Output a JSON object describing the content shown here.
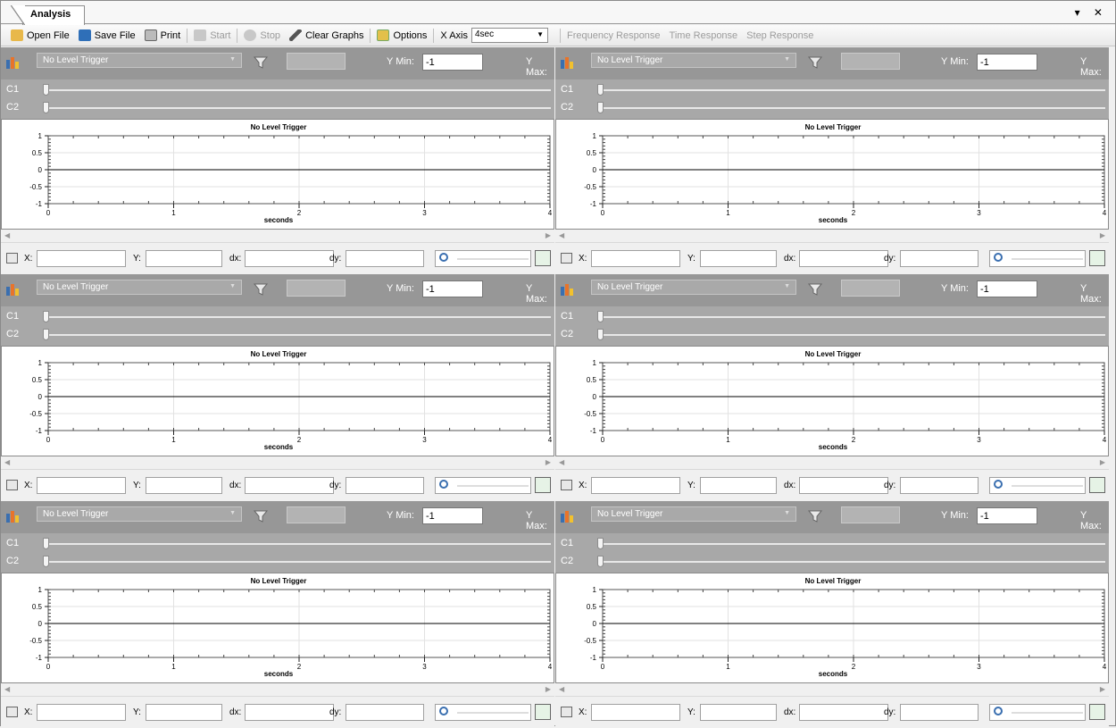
{
  "tab": {
    "label": "Analysis"
  },
  "window_controls": "▾ ✕",
  "toolbar": {
    "open": "Open File",
    "save": "Save File",
    "print": "Print",
    "start": "Start",
    "stop": "Stop",
    "clear": "Clear Graphs",
    "options": "Options",
    "xaxis_label": "X Axis",
    "xaxis_value": "4sec",
    "freq": "Frequency Response",
    "time": "Time Response",
    "step": "Step Response"
  },
  "panel": {
    "trigger": "No Level Trigger",
    "ymin_label": "Y Min:",
    "ymin_value": "-1",
    "ymax_label": "Y Max:",
    "c1": "C1",
    "c2": "C2",
    "chart_title": "No Level Trigger",
    "x_label": "seconds",
    "foot_x": "X:",
    "foot_y": "Y:",
    "foot_dx": "dx:",
    "foot_dy": "dy:"
  },
  "chart_data": {
    "type": "line",
    "title": "No Level Trigger",
    "xlabel": "seconds",
    "ylabel": "",
    "xlim": [
      0,
      4
    ],
    "ylim": [
      -1,
      1
    ],
    "x_ticks": [
      "0",
      "1",
      "2",
      "3",
      "4"
    ],
    "y_ticks": [
      "1",
      "0.5",
      "0",
      "-0.5",
      "-1"
    ],
    "series": [
      {
        "x": [
          0,
          4
        ],
        "y": [
          0,
          0
        ]
      }
    ],
    "grid": true
  },
  "colors": {
    "accent": "#3a6fb0",
    "panel_dark": "#979797",
    "panel_light": "#a8a8a8"
  }
}
